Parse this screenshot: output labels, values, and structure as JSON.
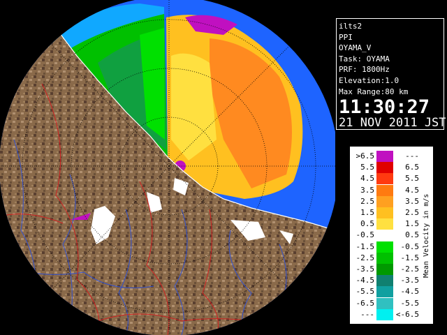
{
  "info": {
    "lines": [
      "ilts2",
      "PPI",
      "OYAMA_V",
      "Task: OYAMA",
      "PRF: 1800Hz",
      "Elevation:1.0",
      "Max Range:80 km"
    ],
    "time": "11:30:27",
    "date": "21 NOV 2011 JST"
  },
  "legend": {
    "title": "Mean Velocity in m/s",
    "rows": [
      {
        "lo": ">6.5",
        "hi": "---",
        "color": "#c010c0"
      },
      {
        "lo": "5.5",
        "hi": "6.5",
        "color": "#e00000"
      },
      {
        "lo": "4.5",
        "hi": "5.5",
        "color": "#ff3a10"
      },
      {
        "lo": "3.5",
        "hi": "4.5",
        "color": "#ff7a10"
      },
      {
        "lo": "2.5",
        "hi": "3.5",
        "color": "#ffa020"
      },
      {
        "lo": "1.5",
        "hi": "2.5",
        "color": "#ffc020"
      },
      {
        "lo": "0.5",
        "hi": "1.5",
        "color": "#ffe040"
      },
      {
        "lo": "-0.5",
        "hi": "0.5",
        "color": "#ffffff"
      },
      {
        "lo": "-1.5",
        "hi": "-0.5",
        "color": "#00e000"
      },
      {
        "lo": "-2.5",
        "hi": "-1.5",
        "color": "#00c000"
      },
      {
        "lo": "-3.5",
        "hi": "-2.5",
        "color": "#009900"
      },
      {
        "lo": "-4.5",
        "hi": "-3.5",
        "color": "#108070"
      },
      {
        "lo": "-5.5",
        "hi": "-4.5",
        "color": "#10a0a0"
      },
      {
        "lo": "-6.5",
        "hi": "-5.5",
        "color": "#30c0c0"
      },
      {
        "lo": "---",
        "hi": "<-6.5",
        "color": "#00f0f0"
      }
    ]
  },
  "colors": {
    "sea": "#1e64ff",
    "coverage": "#0f9bff",
    "terrain": "#8a6a4a",
    "receding": "#ffa020",
    "approaching": "#00c000",
    "rivers": "#3050d0",
    "borders": "#d02020"
  }
}
